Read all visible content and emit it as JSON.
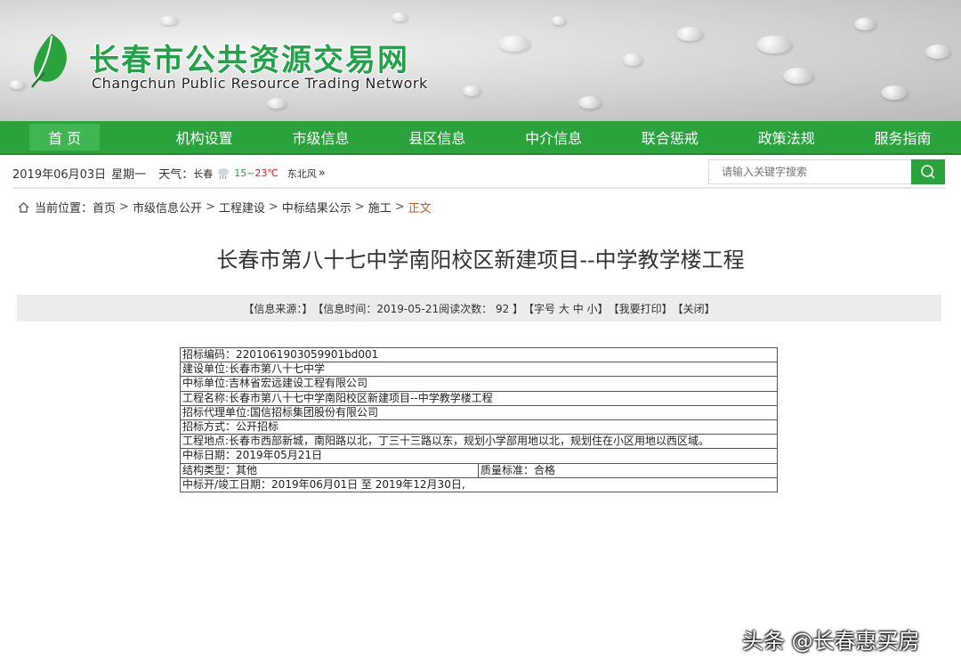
{
  "header": {
    "site_title": "长春市公共资源交易网",
    "site_subtitle": "Changchun Public Resource Trading Network",
    "logo_icon": "leaf-logo-icon",
    "brand_color": "#2ba33d"
  },
  "nav": {
    "items": [
      {
        "label": "首 页",
        "active": true
      },
      {
        "label": "机构设置"
      },
      {
        "label": "市级信息"
      },
      {
        "label": "县区信息"
      },
      {
        "label": "中介信息"
      },
      {
        "label": "联合惩戒"
      },
      {
        "label": "政策法规"
      },
      {
        "label": "服务指南"
      }
    ]
  },
  "infobar": {
    "date": "2019年06月03日",
    "weekday": "星期一",
    "weather_label": "天气：",
    "city": "长春",
    "temp_low": "15",
    "temp_sep": "~",
    "temp_high": "23℃",
    "wind": "东北风",
    "more": "»",
    "search_placeholder": "请输入关键字搜索",
    "search_icon": "search-icon"
  },
  "breadcrumb": {
    "prefix": "当前位置：",
    "items": [
      "首页",
      "市级信息公开",
      "工程建设",
      "中标结果公示",
      "施工"
    ],
    "current": "正文",
    "separator": ">"
  },
  "article": {
    "title": "长春市第八十七中学南阳校区新建项目--中学教学楼工程",
    "meta": {
      "source": "【信息来源：】",
      "time": "【信息时间：2019-05-21阅读次数： 92 】",
      "font_prefix": "【字号 ",
      "font_large": "大",
      "font_medium": "中",
      "font_small": "小",
      "font_suffix": "】",
      "print": "【我要打印】",
      "close": "【关闭】"
    },
    "table": {
      "code": "招标编码：2201061903059901bd001",
      "builder": "建设单位:长春市第八十七中学",
      "winner": "中标单位:吉林省宏远建设工程有限公司",
      "project": "工程名称:长春市第八十七中学南阳校区新建项目--中学教学楼工程",
      "agent": "招标代理单位:国信招标集团股份有限公司",
      "method": "招标方式：公开招标",
      "location": "工程地点:长春市西部新城，南阳路以北，丁三十三路以东，规划小学部用地以北，规划住在小区用地以西区域。",
      "date": "中标日期：2019年05月21日",
      "structure": "结构类型：其他",
      "quality": "质量标准：合格",
      "period": "中标开/竣工日期：2019年06月01日 至 2019年12月30日,"
    }
  },
  "watermark": "头条 @长春惠买房"
}
